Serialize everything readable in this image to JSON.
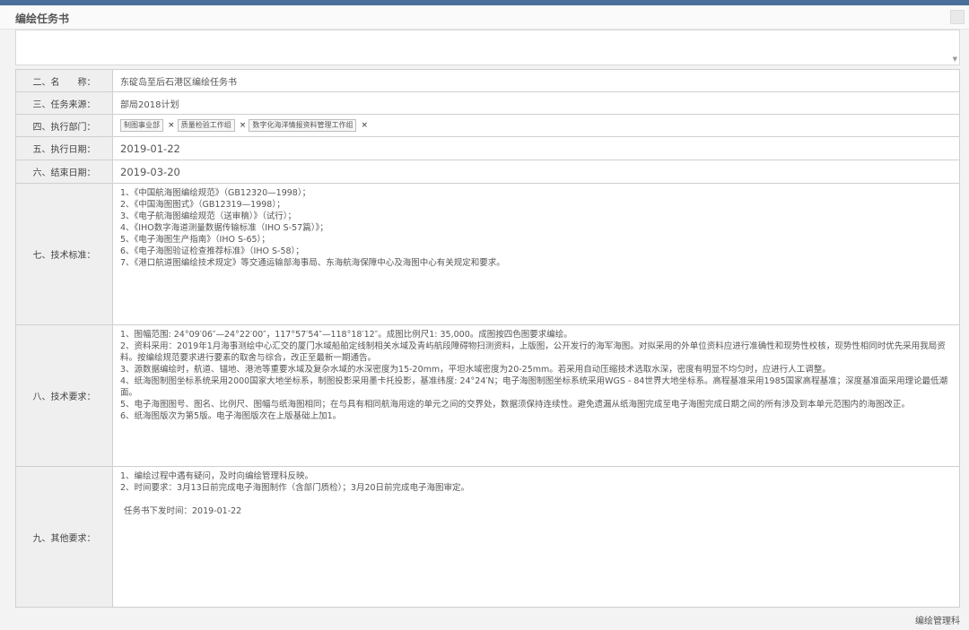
{
  "header": {
    "title": "编绘任务书"
  },
  "rows": {
    "name": {
      "label": "二、名　　称：",
      "value": "东碇岛至后石港区编绘任务书"
    },
    "source": {
      "label": "三、任务来源：",
      "value": "部局2018计划"
    },
    "departments": {
      "label": "四、执行部门：",
      "tags": [
        "制图事业部",
        "质量检验工作组",
        "数字化海洋情报资料管理工作组"
      ],
      "remove_glyph": "×"
    },
    "start_date": {
      "label": "五、执行日期：",
      "value": "2019-01-22"
    },
    "end_date": {
      "label": "六、结束日期：",
      "value": "2019-03-20"
    },
    "tech_standard": {
      "label": "七、技术标准：",
      "lines": [
        "1、《中国航海图编绘规范》（GB12320—1998）；",
        "2、《中国海图图式》（GB12319—1998）；",
        "3、《电子航海图编绘规范（送审稿）》（试行）；",
        "4、《IHO数字海道测量数据传输标准（IHO S-57篇）》；",
        "5、《电子海图生产指南》（IHO S-65）；",
        "6、《电子海图验证检查推荐标准》（IHO S-58）；",
        "7、《港口航道图编绘技术规定》等交通运输部海事局、东海航海保障中心及海图中心有关规定和要求。"
      ]
    },
    "tech_requirement": {
      "label": "八、技术要求：",
      "lines": [
        "1、图幅范围: 24°09′06″—24°22′00″，117°57′54″—118°18′12″。成图比例尺1: 35,000。成图按四色图要求编绘。",
        "2、资料采用：2019年1月海事测绘中心汇交的厦门水域船舶定线制相关水域及青屿航段障碍物扫测资料，上版图，公开发行的海军海图。对拟采用的外单位资料应进行准确性和现势性校核，现势性相同时优先采用我局资料。按编绘规范要求进行要素的取舍与综合，改正至最新一期通告。",
        "3、源数据编绘时，航道、锚地、港池等重要水域及复杂水域的水深密度为15-20mm，平坦水域密度为20-25mm。若采用自动压缩技术选取水深，密度有明显不均匀时，应进行人工调整。",
        "4、纸海图制图坐标系统采用2000国家大地坐标系，制图投影采用墨卡托投影，基准纬度: 24°24′N；电子海图制图坐标系统采用WGS - 84世界大地坐标系。高程基准采用1985国家高程基准；深度基准面采用理论最低潮面。",
        "5、电子海图图号、图名、比例尺、图幅与纸海图相同；在与具有相同航海用途的单元之间的交界处，数据须保持连续性。避免遗漏从纸海图完成至电子海图完成日期之间的所有涉及到本单元范围内的海图改正。",
        "6、纸海图版次为第5版。电子海图版次在上版基础上加1。"
      ]
    },
    "other_requirement": {
      "label": "九、其他要求：",
      "lines": [
        "1、编绘过程中遇有疑问，及时向编绘管理科反映。",
        "2、时间要求：3月13日前完成电子海图制作（含部门质检）；3月20日前完成电子海图审定。"
      ],
      "issue_label": "任务书下发时间：",
      "issue_date": "2019-01-22"
    }
  },
  "footer": {
    "issuer": "编绘管理科"
  }
}
